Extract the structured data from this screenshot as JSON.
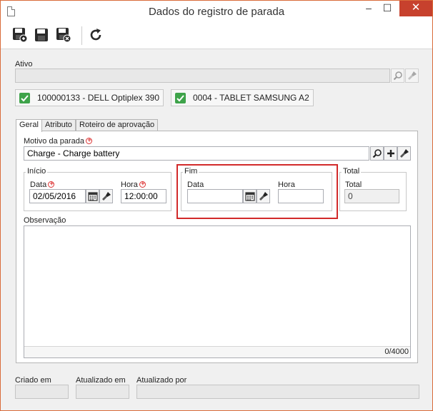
{
  "window": {
    "title": "Dados do registro de parada",
    "minimize_label": "–",
    "maximize_label": "☐",
    "close_label": "✕"
  },
  "toolbar": {
    "icons": [
      "save-new-icon",
      "save-icon",
      "save-close-icon",
      "refresh-icon"
    ]
  },
  "ativo": {
    "label": "Ativo",
    "value": "",
    "chips": [
      {
        "label": "100000133 - DELL Optiplex 390"
      },
      {
        "label": "0004 - TABLET SAMSUNG A2"
      }
    ]
  },
  "tabs": [
    {
      "label": "Geral"
    },
    {
      "label": "Atributo"
    },
    {
      "label": "Roteiro de aprovação"
    }
  ],
  "geral": {
    "motivo": {
      "label": "Motivo da parada",
      "value": "Charge - Charge battery"
    },
    "inicio": {
      "label": "Início",
      "data_label": "Data",
      "data_value": "02/05/2016",
      "hora_label": "Hora",
      "hora_value": "12:00:00"
    },
    "fim": {
      "label": "Fim",
      "data_label": "Data",
      "data_value": "",
      "hora_label": "Hora",
      "hora_value": ""
    },
    "total": {
      "label": "Total",
      "total_label": "Total",
      "value": "0"
    },
    "observacao": {
      "label": "Observação",
      "value": "",
      "counter": "0/4000"
    }
  },
  "footer": {
    "criado_em": {
      "label": "Criado em",
      "value": ""
    },
    "atualizado_em": {
      "label": "Atualizado em",
      "value": ""
    },
    "atualizado_por": {
      "label": "Atualizado por",
      "value": ""
    }
  },
  "colors": {
    "accent_border": "#d96b3a",
    "close_button": "#c7412d",
    "highlight": "#d22a2a",
    "check": "#3ea34a"
  }
}
